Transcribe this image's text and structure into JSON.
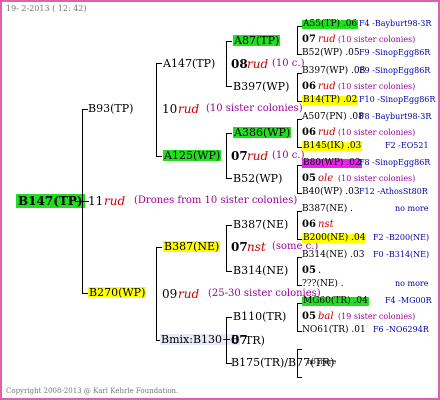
{
  "header": "19-  2-2013 ( 12: 42)",
  "footer": "Copyright 2008-2013 @ Karl Kehrle Foundation.",
  "colors": {
    "frame": "#e060b0",
    "green": "#22dd22",
    "yellow": "#ffff00",
    "magenta": "#ee22ee",
    "red": "#cc0000",
    "blue": "#0000aa"
  },
  "root": {
    "code": "B147(TP)",
    "gen_num": "11",
    "gen_mark": "rud",
    "drones": "(Drones from 10 sister colonies)"
  },
  "g1": [
    {
      "code": "B93(TP)",
      "num": "10",
      "mark": "rud",
      "sis": "(10 sister colonies)"
    },
    {
      "code": "B270(WP)",
      "num": "09",
      "mark": "rud",
      "sis": "(25-30 sister colonies)"
    }
  ],
  "g2": [
    {
      "code": "A147(TP)",
      "num": "08",
      "mark": "rud",
      "sis": "(10 c.)"
    },
    {
      "code": "A125(WP)",
      "num": "07",
      "mark": "rud",
      "sis": "(10 c.)"
    },
    {
      "code": "B387(NE)",
      "num": "07",
      "mark": "nst",
      "sis": "(some c.)"
    },
    {
      "code": "Bmix:B130+B",
      "num": "07",
      "code_tail": "TR)"
    }
  ],
  "g3": [
    "A87(TP)",
    "B397(WP)",
    "A386(WP)",
    "B52(WP)",
    "B387(NE)",
    "B314(NE)",
    "B110(TR)",
    "B175(TR)/B77(TR)"
  ],
  "g3_tail": "no more",
  "g4": [
    {
      "code": "A55(TP) .06",
      "info": "F4 -Bayburt98-3R",
      "num": "07",
      "mark": "rud",
      "sis": "(10 sister colonies)",
      "code2": "B52(WP) .05",
      "info2": "F9 -SinopEgg86R"
    },
    {
      "code": "B397(WP) .08",
      "info": "F9 -SinopEgg86R",
      "num": "06",
      "mark": "rud",
      "sis": "(10 sister colonies)",
      "code2": "B14(TP) .02",
      "info2": "F10 -SinopEgg86R"
    },
    {
      "code": "A507(PN) .08",
      "info": "F8 -Bayburt98-3R",
      "num": "06",
      "mark": "rud",
      "sis": "(10 sister colonies)",
      "code2": "B145(IK) .03",
      "info2": "F2 -EO521"
    },
    {
      "code": "B80(WP) .02",
      "info": "F8 -SinopEgg86R",
      "num": "05",
      "mark": "ole",
      "sis": "(10 sister colonies)",
      "code2": "B40(WP) .03",
      "info2": "F12 -AthosSt80R"
    },
    {
      "code": "B387(NE) .",
      "info": "no more",
      "num": "06",
      "mark": "nst",
      "sis": "",
      "code2": "B200(NE) .04",
      "info2": "F2 -B200(NE)"
    },
    {
      "code": "B314(NE) .03",
      "info": "F0 -B314(NE)",
      "num": "05",
      "mark": ".",
      "sis": "",
      "code2": "???(NE) .",
      "info2": "no more"
    },
    {
      "code": "MG60(TR) .04",
      "info": "F4 -MG00R",
      "num": "05",
      "mark": "bal",
      "sis": "(19 sister colonies)",
      "code2": "NO61(TR) .01",
      "info2": "F6 -NO6294R"
    }
  ]
}
